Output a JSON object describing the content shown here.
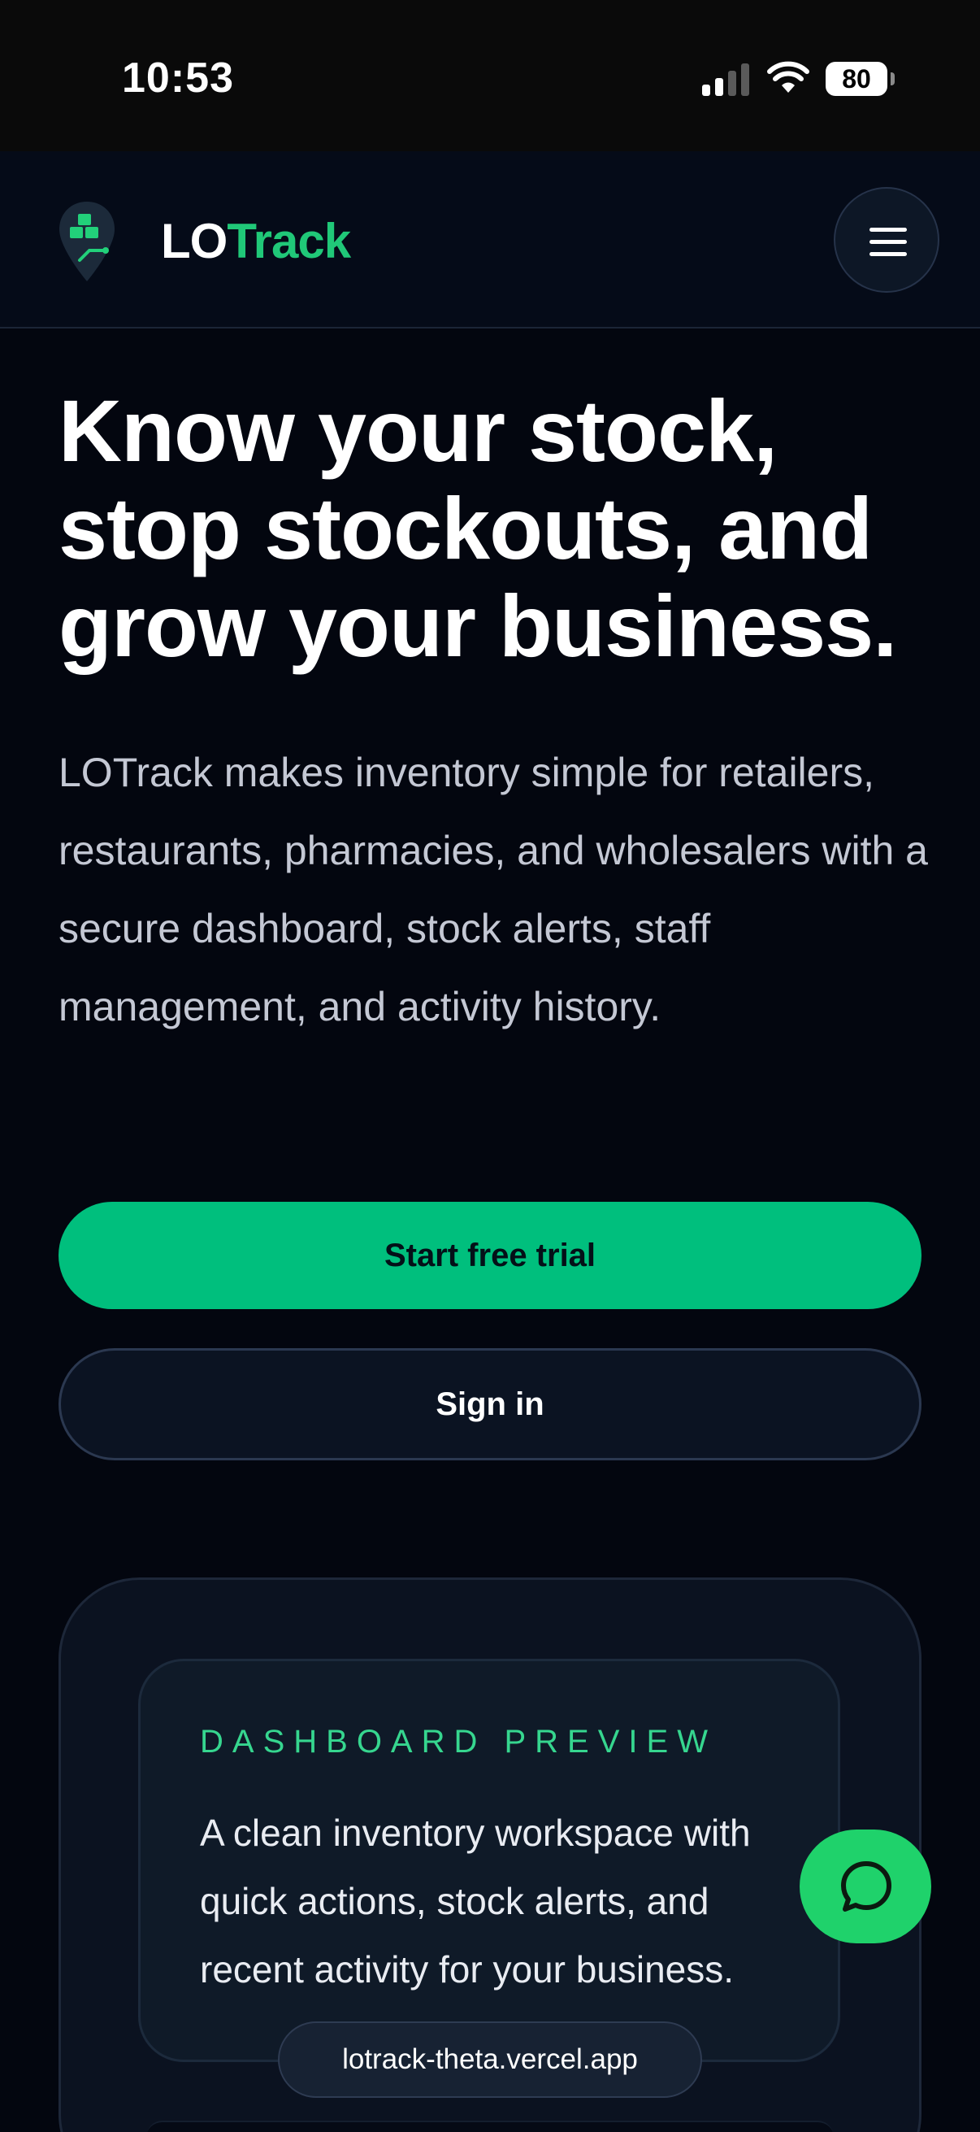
{
  "status_bar": {
    "time": "10:53",
    "battery": "80",
    "icons": [
      "signal-icon",
      "wifi-icon",
      "battery-icon"
    ]
  },
  "header": {
    "brand_lo": "LO",
    "brand_track": "Track",
    "logo_icon": "map-pin-boxes-icon",
    "menu_icon": "hamburger-menu-icon"
  },
  "hero": {
    "title": "Know your stock, stop stockouts, and grow your business.",
    "body": "LOTrack makes inventory simple for retailers, restaurants, pharmacies, and wholesalers with a secure dashboard, stock alerts, staff management, and activity history.",
    "primary_cta": "Start free trial",
    "secondary_cta": "Sign in"
  },
  "preview": {
    "eyebrow": "DASHBOARD PREVIEW",
    "description": "A clean inventory workspace with quick actions, stock alerts, and recent activity for your business."
  },
  "browser": {
    "url": "lotrack-theta.vercel.app"
  },
  "chat": {
    "icon": "chat-bubble-icon"
  },
  "colors": {
    "background": "#03060f",
    "accent_green": "#00bf7d",
    "brand_green": "#20c878",
    "eyebrow_green": "#36d68f",
    "chat_green": "#1fd26b"
  }
}
